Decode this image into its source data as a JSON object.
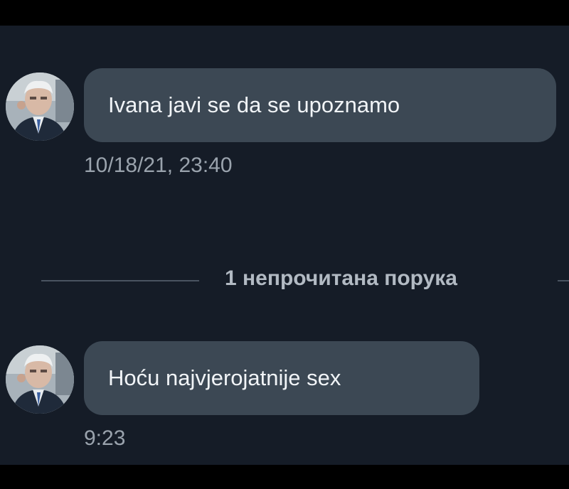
{
  "messages": [
    {
      "text": "Ivana javi se da se upoznamo",
      "timestamp": "10/18/21, 23:40",
      "avatar": "contact-avatar"
    },
    {
      "text": "Hoću najvjerojatnije sex",
      "timestamp": "9:23",
      "avatar": "contact-avatar"
    }
  ],
  "unread_divider": {
    "label": "1 непрочитана порука"
  },
  "colors": {
    "background": "#151c27",
    "bubble": "#3c4854",
    "message_text": "#f1f4f7",
    "timestamp_text": "#9aa3ad",
    "divider_text": "#b2bac3",
    "divider_line": "#4a5461"
  }
}
